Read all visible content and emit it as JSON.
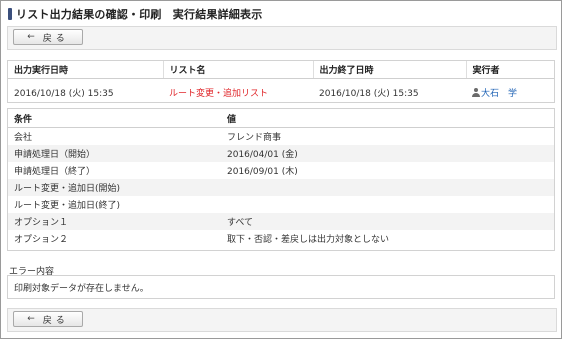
{
  "page": {
    "title": "リスト出力結果の確認・印刷　実行結果詳細表示"
  },
  "buttons": {
    "back_arrow": "←",
    "back_label": "戻る"
  },
  "info": {
    "headers": [
      "出力実行日時",
      "リスト名",
      "出力終了日時",
      "実行者"
    ],
    "start_datetime": "2016/10/18 (火) 15:35",
    "list_name": "ルート変更・追加リスト",
    "end_datetime": "2016/10/18 (火) 15:35",
    "executor": "大石　学",
    "user_icon": "user-icon"
  },
  "conditions": {
    "headers": [
      "条件",
      "値"
    ],
    "rows": [
      {
        "key": "会社",
        "value": "フレンド商事"
      },
      {
        "key": "申請処理日（開始）",
        "value": "2016/04/01 (金)"
      },
      {
        "key": "申請処理日（終了）",
        "value": "2016/09/01 (木)"
      },
      {
        "key": "ルート変更・追加日(開始)",
        "value": ""
      },
      {
        "key": "ルート変更・追加日(終了)",
        "value": ""
      },
      {
        "key": "オプション１",
        "value": "すべて"
      },
      {
        "key": "オプション２",
        "value": "取下・否認・差戻しは出力対象としない"
      }
    ]
  },
  "error": {
    "label": "エラー内容",
    "message": "印刷対象データが存在しません。"
  },
  "colors": {
    "title_mark": "#3b4f7c",
    "list_name": "#e0262a",
    "user_link": "#1f63b5"
  }
}
